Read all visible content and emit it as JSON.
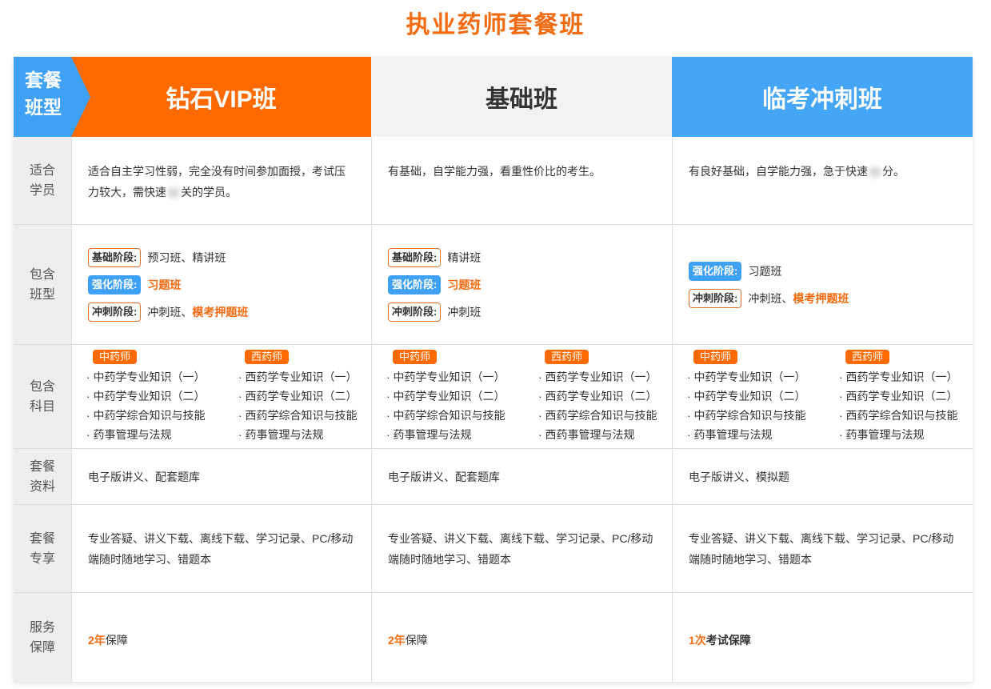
{
  "page_title": "执业药师套餐班",
  "header": {
    "corner_line1": "套餐",
    "corner_line2": "班型",
    "plans": [
      "钻石VIP班",
      "基础班",
      "临考冲刺班"
    ]
  },
  "row_labels": {
    "suitable": [
      "适合",
      "学员"
    ],
    "included_classes": [
      "包含",
      "班型"
    ],
    "subjects": [
      "包含",
      "科目"
    ],
    "materials": [
      "套餐",
      "资料"
    ],
    "exclusive": [
      "套餐",
      "专享"
    ],
    "service": [
      "服务",
      "保障"
    ]
  },
  "suitable": {
    "vip_part1": "适合自主学习性弱，完全没有时间参加面授，考试压力较大，需快速",
    "vip_part2": "关的学员。",
    "basic": "有基础，自学能力强，看重性价比的考生。",
    "sprint_part1": "有良好基础，自学能力强，急于快速",
    "sprint_part2": "分。"
  },
  "stages": {
    "foundation": "基础阶段:",
    "strengthen": "强化阶段:",
    "sprint": "冲刺阶段:"
  },
  "included_classes": {
    "vip": {
      "foundation": "预习班、精讲班",
      "strengthen": "习题班",
      "sprint_plain": "冲刺班、",
      "sprint_highlight": "模考押题班"
    },
    "basic": {
      "foundation": "精讲班",
      "strengthen": "习题班",
      "sprint": "冲刺班"
    },
    "sprint_plan": {
      "strengthen": "习题班",
      "sprint_plain": "冲刺班、",
      "sprint_highlight": "模考押题班"
    }
  },
  "subjects": {
    "tcm_badge": "中药师",
    "wm_badge": "西药师",
    "tcm": [
      "· 中药学专业知识（一）",
      "· 中药学专业知识（二）",
      "· 中药学综合知识与技能",
      "· 药事管理与法规"
    ],
    "wm_vip": [
      "· 西药学专业知识（一）",
      "· 西药学专业知识（二）",
      "· 西药学综合知识与技能",
      "· 药事管理与法规"
    ],
    "wm_basic": [
      "· 西药学专业知识（一）",
      "· 西药学专业知识（二）",
      "· 西药学综合知识与技能",
      "· 西药事管理与法规"
    ],
    "wm_sprint": [
      "· 西药学专业知识（一）",
      "· 西药学专业知识（二）",
      "· 西药学综合知识与技能",
      "· 药事管理与法规"
    ]
  },
  "materials": {
    "vip": "电子版讲义、配套题库",
    "basic": "电子版讲义、配套题库",
    "sprint": "电子版讲义、模拟题"
  },
  "exclusive": {
    "line1": "专业答疑、讲义下载、离线下载、学习记录、PC/移动",
    "line2": "端随时随地学习、错题本"
  },
  "service": {
    "vip_num": "2年",
    "vip_text": "保障",
    "basic_num": "2年",
    "basic_text": "保障",
    "sprint_num": "1次",
    "sprint_text": "考试保障"
  },
  "colors": {
    "accent_orange": "#ff6a00",
    "title_orange": "#f36c12",
    "accent_blue": "#3fa1f5",
    "label_gray": "#eeeeee"
  }
}
